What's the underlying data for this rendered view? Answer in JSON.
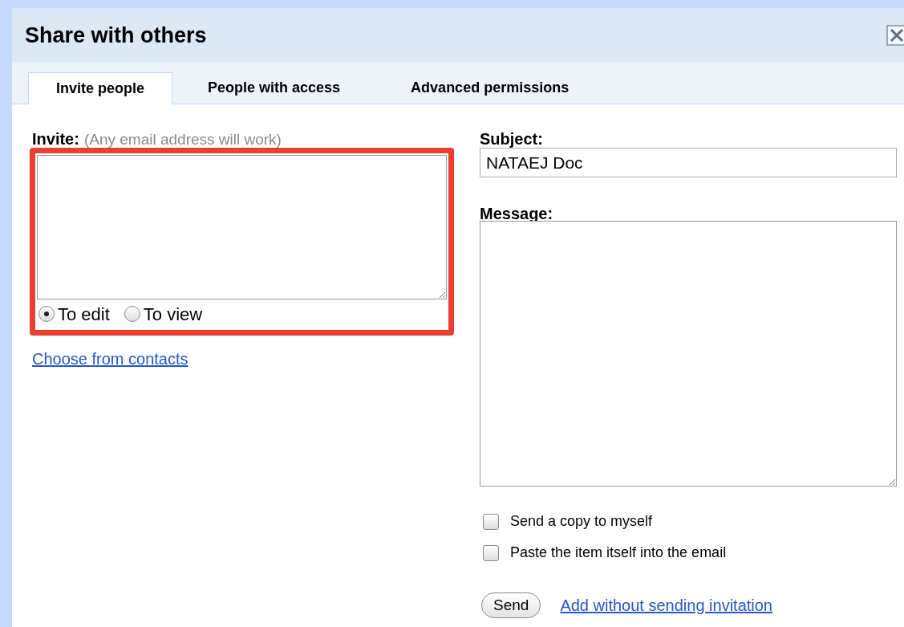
{
  "dialog": {
    "title": "Share with others"
  },
  "tabs": [
    {
      "label": "Invite people",
      "selected": true
    },
    {
      "label": "People with access",
      "selected": false
    },
    {
      "label": "Advanced permissions",
      "selected": false
    }
  ],
  "invite": {
    "label": "Invite:",
    "hint": "(Any email address will work)",
    "highlighted": true,
    "roles": [
      {
        "label": "To edit",
        "selected": true
      },
      {
        "label": "To view",
        "selected": false
      }
    ],
    "contacts_link": "Choose from contacts"
  },
  "subject": {
    "label": "Subject:",
    "value": "NATAEJ Doc"
  },
  "message": {
    "label": "Message:"
  },
  "options": [
    {
      "label": "Send a copy to myself",
      "checked": false
    },
    {
      "label": "Paste the item itself into the email",
      "checked": false
    }
  ],
  "send_button": "Send",
  "add_link": "Add without sending invitation"
}
